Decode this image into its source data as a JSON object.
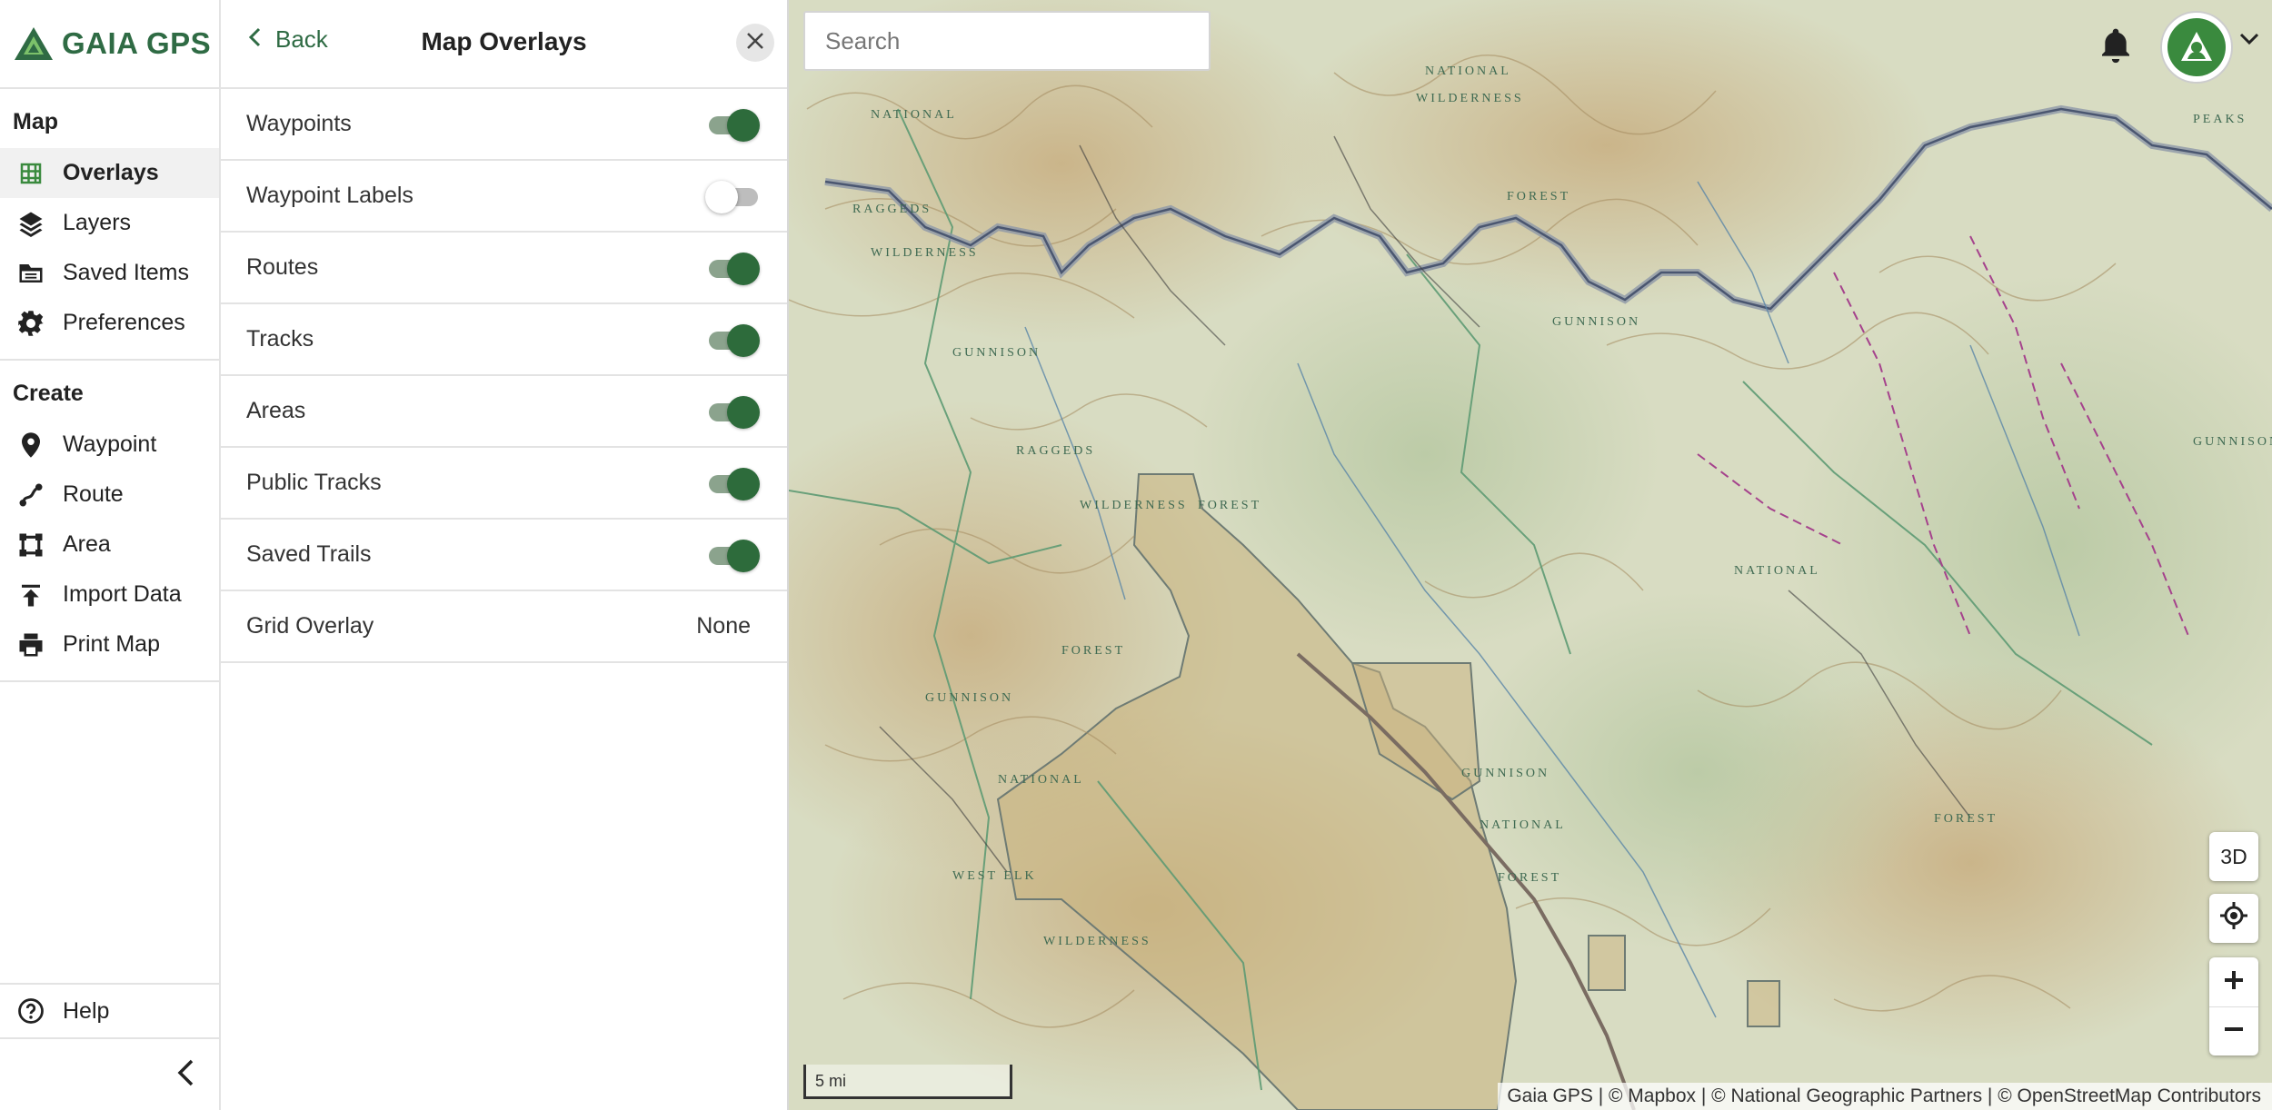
{
  "brand": {
    "name": "GAIA GPS"
  },
  "nav": {
    "map_heading": "Map",
    "map_items": [
      {
        "label": "Overlays",
        "icon": "grid-icon",
        "active": true
      },
      {
        "label": "Layers",
        "icon": "layers-icon"
      },
      {
        "label": "Saved Items",
        "icon": "folder-icon"
      },
      {
        "label": "Preferences",
        "icon": "gear-icon"
      }
    ],
    "create_heading": "Create",
    "create_items": [
      {
        "label": "Waypoint",
        "icon": "pin-icon"
      },
      {
        "label": "Route",
        "icon": "route-icon"
      },
      {
        "label": "Area",
        "icon": "area-icon"
      },
      {
        "label": "Import Data",
        "icon": "upload-icon"
      },
      {
        "label": "Print Map",
        "icon": "printer-icon"
      }
    ],
    "help_label": "Help"
  },
  "panel": {
    "back_label": "Back",
    "title": "Map Overlays",
    "overlays": [
      {
        "label": "Waypoints",
        "on": true
      },
      {
        "label": "Waypoint Labels",
        "on": false
      },
      {
        "label": "Routes",
        "on": true
      },
      {
        "label": "Tracks",
        "on": true
      },
      {
        "label": "Areas",
        "on": true
      },
      {
        "label": "Public Tracks",
        "on": true
      },
      {
        "label": "Saved Trails",
        "on": true
      }
    ],
    "grid_overlay": {
      "label": "Grid Overlay",
      "value": "None"
    }
  },
  "map": {
    "search_placeholder": "Search",
    "btn_3d": "3D",
    "scale_label": "5 mi",
    "attribution": "Gaia GPS | © Mapbox | © National Geographic Partners | © OpenStreetMap Contributors",
    "labels": [
      "NATIONAL",
      "WILDERNESS",
      "NATIONAL",
      "FOREST",
      "GUNNISON",
      "NATIONAL",
      "FOREST",
      "GUNNISON",
      "NATIONAL",
      "FOREST",
      "PEAKS",
      "GUNNISON",
      "WILDERNESS",
      "RAGGEDS",
      "GUNNISON",
      "FOREST",
      "WILDERNESS",
      "WEST ELK",
      "NATIONAL",
      "FOREST",
      "RAGGEDS",
      "GUNNISON",
      "WILDERNESS"
    ]
  },
  "colors": {
    "accent": "#2f6b44",
    "toggle_on": "#2d6b3b",
    "active_icon": "#3a8a3e"
  }
}
